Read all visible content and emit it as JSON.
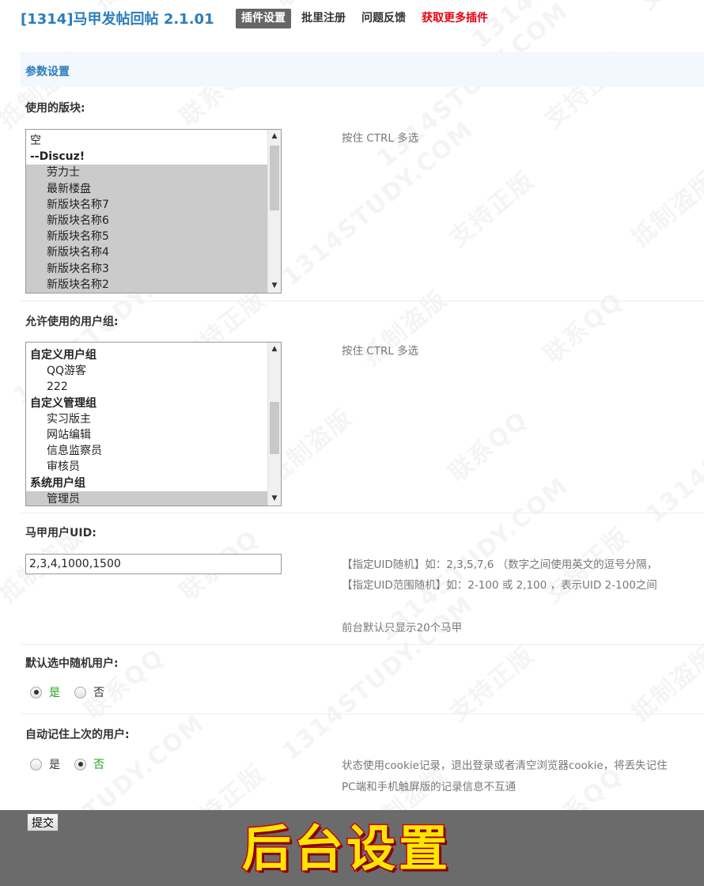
{
  "header": {
    "app_title": "[1314]马甲发帖回帖 2.1.01",
    "tabs": [
      {
        "label": "插件设置"
      },
      {
        "label": "批里注册"
      },
      {
        "label": "问题反馈"
      },
      {
        "label": "获取更多插件"
      }
    ]
  },
  "section": {
    "title": "参数设置"
  },
  "forums_field": {
    "label": "使用的版块:",
    "hint": "按住 CTRL 多选",
    "options": [
      {
        "text": "空",
        "kind": "plain",
        "selected": false
      },
      {
        "text": "--Discuz!",
        "kind": "group",
        "selected": false
      },
      {
        "text": "劳力士",
        "kind": "item",
        "selected": true
      },
      {
        "text": "最新楼盘",
        "kind": "item",
        "selected": true
      },
      {
        "text": "新版块名称7",
        "kind": "item",
        "selected": true
      },
      {
        "text": "新版块名称6",
        "kind": "item",
        "selected": true
      },
      {
        "text": "新版块名称5",
        "kind": "item",
        "selected": true
      },
      {
        "text": "新版块名称4",
        "kind": "item",
        "selected": true
      },
      {
        "text": "新版块名称3",
        "kind": "item",
        "selected": true
      },
      {
        "text": "新版块名称2",
        "kind": "item",
        "selected": true
      }
    ]
  },
  "groups_field": {
    "label": "允许使用的用户组:",
    "hint": "按住 CTRL 多选",
    "options": [
      {
        "text": "自定义用户组",
        "kind": "group",
        "selected": false
      },
      {
        "text": "QQ游客",
        "kind": "item",
        "selected": false
      },
      {
        "text": "222",
        "kind": "item",
        "selected": false
      },
      {
        "text": "自定义管理组",
        "kind": "group",
        "selected": false
      },
      {
        "text": "实习版主",
        "kind": "item",
        "selected": false
      },
      {
        "text": "网站编辑",
        "kind": "item",
        "selected": false
      },
      {
        "text": "信息监察员",
        "kind": "item",
        "selected": false
      },
      {
        "text": "审核员",
        "kind": "item",
        "selected": false
      },
      {
        "text": "系统用户组",
        "kind": "group",
        "selected": false
      },
      {
        "text": "管理员",
        "kind": "item",
        "selected": true
      }
    ]
  },
  "uid_field": {
    "label": "马甲用户UID:",
    "value": "2,3,4,1000,1500",
    "hint_line1": "【指定UID随机】如：2,3,5,7,6 （数字之间使用英文的逗号分隔，",
    "hint_line2": "【指定UID范围随机】如：2-100 或 2,100 ，表示UID 2-100之间",
    "hint_line3": "前台默认只显示20个马甲"
  },
  "random_user_field": {
    "label": "默认选中随机用户:",
    "options": [
      {
        "text": "是",
        "checked": true
      },
      {
        "text": "否",
        "checked": false
      }
    ]
  },
  "remember_field": {
    "label": "自动记住上次的用户:",
    "options": [
      {
        "text": "是",
        "checked": false
      },
      {
        "text": "否",
        "checked": true
      }
    ],
    "hint_line1": "状态使用cookie记录，退出登录或者清空浏览器cookie，将丢失记住",
    "hint_line2": "PC端和手机触屏版的记录信息不互通"
  },
  "submit_label": "提交",
  "banner_text": "后台设置",
  "colors": {
    "accent": "#2b7dbc",
    "active_tab": "#666666",
    "promo_link": "#e60012",
    "chosen_radio": "#1ca31c",
    "banner_bg": "#6b6b6b",
    "banner_text": "#ffe600"
  }
}
